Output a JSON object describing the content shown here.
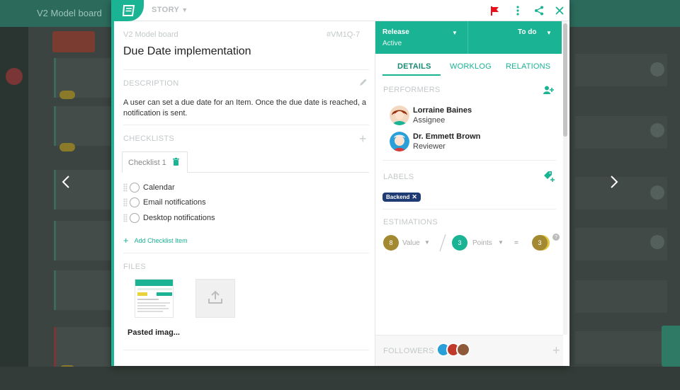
{
  "background": {
    "board_title": "V2 Model board"
  },
  "header": {
    "item_type": "STORY"
  },
  "item": {
    "board_name": "V2 Model board",
    "id": "#VM1Q-7",
    "title": "Due Date implementation"
  },
  "description": {
    "heading": "DESCRIPTION",
    "text": "A user can set a due date for an Item. Once the due date is reached, a notification is sent."
  },
  "checklists": {
    "heading": "CHECKLISTS",
    "tab_label": "Checklist 1",
    "items": [
      {
        "label": "Calendar"
      },
      {
        "label": "Email notifications"
      },
      {
        "label": "Desktop notifications"
      }
    ],
    "add_label": "Add Checklist Item"
  },
  "files": {
    "heading": "FILES",
    "items": [
      {
        "name": "Pasted imag..."
      }
    ]
  },
  "status": {
    "board": "Release",
    "board_state": "Active",
    "column": "To do"
  },
  "tabs": {
    "details": "DETAILS",
    "worklog": "WORKLOG",
    "relations": "RELATIONS"
  },
  "performers": {
    "heading": "PERFORMERS",
    "people": [
      {
        "name": "Lorraine Baines",
        "role": "Assignee"
      },
      {
        "name": "Dr. Emmett Brown",
        "role": "Reviewer"
      }
    ]
  },
  "labels": {
    "heading": "LABELS",
    "items": [
      {
        "name": "Backend"
      }
    ]
  },
  "estimations": {
    "heading": "ESTIMATIONS",
    "value": "8",
    "value_label": "Value",
    "points": "3",
    "points_label": "Points",
    "equals": "=",
    "result": "3",
    "help": "?"
  },
  "followers": {
    "heading": "FOLLOWERS"
  },
  "colors": {
    "accent": "#1ab394",
    "flag": "#e8101a",
    "label_bg": "#1f3b73",
    "value_circle": "#a38a32",
    "points_circle": "#1ab394",
    "result_circle": "#a38a32"
  },
  "icons": {
    "story": "book-icon",
    "flag": "flag-icon",
    "more": "more-vertical-icon",
    "share": "share-icon",
    "close": "close-icon",
    "edit": "pencil-icon",
    "add_performer": "add-user-icon",
    "add_label": "tag-plus-icon",
    "upload": "upload-icon",
    "trash": "trash-icon"
  }
}
